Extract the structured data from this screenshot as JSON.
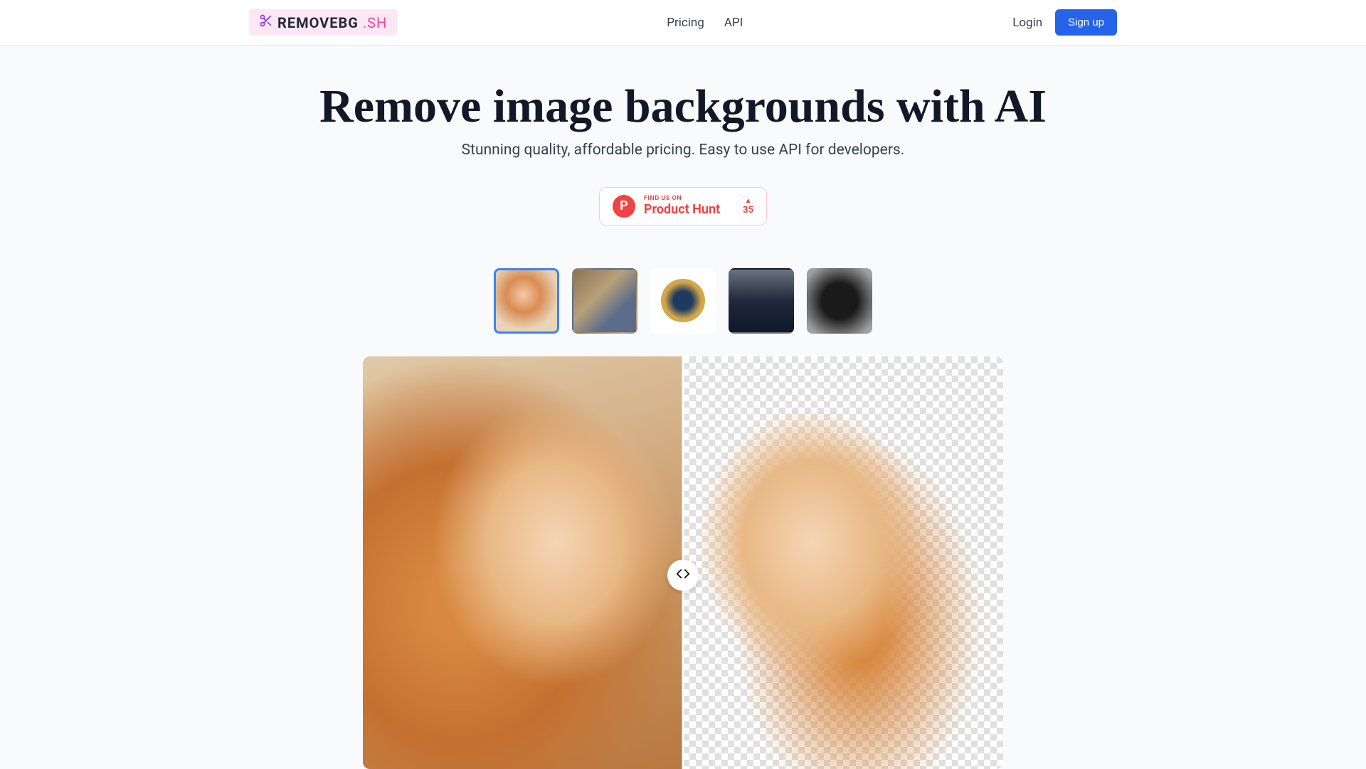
{
  "header": {
    "logo_text": "REMOVEBG",
    "logo_suffix": ".SH",
    "nav": {
      "pricing": "Pricing",
      "api": "API"
    },
    "auth": {
      "login": "Login",
      "signup": "Sign up"
    }
  },
  "hero": {
    "title": "Remove image backgrounds with AI",
    "subtitle": "Stunning quality, affordable pricing. Easy to use API for developers."
  },
  "product_hunt": {
    "top_line": "FIND US ON",
    "bottom_line": "Product Hunt",
    "icon_letter": "P",
    "upvote_count": "35"
  },
  "thumbnails": [
    {
      "name": "portrait-woman-redhead",
      "selected": true
    },
    {
      "name": "portrait-woman-sitting",
      "selected": false
    },
    {
      "name": "graphic-gone-fishing",
      "selected": false
    },
    {
      "name": "car-tesla",
      "selected": false
    },
    {
      "name": "backpack-black",
      "selected": false
    }
  ],
  "comparison": {
    "slider_position_percent": 50
  },
  "colors": {
    "primary_blue": "#2563eb",
    "logo_pink_bg": "#fce7f3",
    "accent_pink": "#ec4899",
    "ph_red": "#ef4444"
  }
}
